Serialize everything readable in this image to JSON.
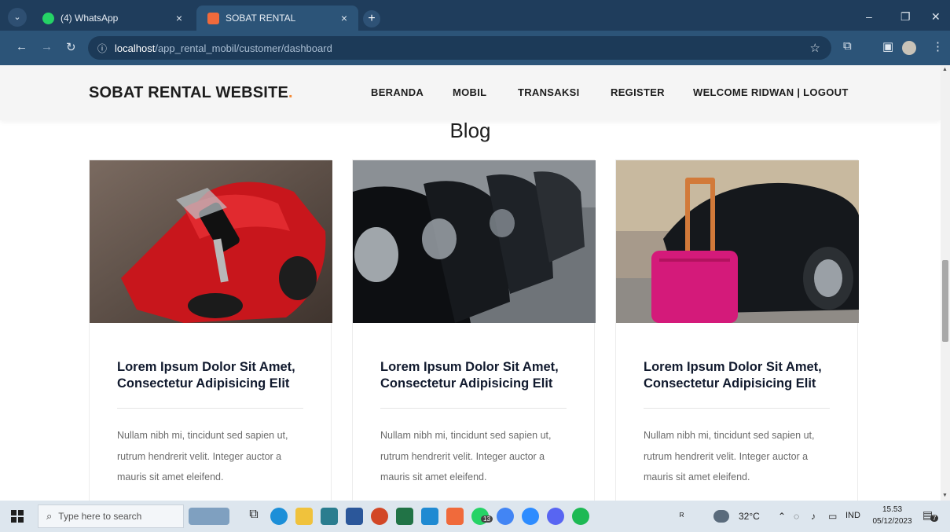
{
  "browser": {
    "tabs": [
      {
        "label": "(4) WhatsApp",
        "close": "×"
      },
      {
        "label": "SOBAT RENTAL",
        "close": "×"
      }
    ],
    "new_tab": "+",
    "window_controls": {
      "minimize": "–",
      "restore": "❐",
      "close": "✕"
    },
    "url_host": "localhost",
    "url_path": "/app_rental_mobil/customer/dashboard"
  },
  "site": {
    "brand": "SOBAT RENTAL WEBSITE",
    "brand_dot": ".",
    "menu": [
      "BERANDA",
      "MOBIL",
      "TRANSAKSI",
      "REGISTER",
      "WELCOME RIDWAN | LOGOUT"
    ],
    "blog_heading": "Blog",
    "cards": [
      {
        "title": "Lorem Ipsum Dolor Sit Amet, Consectetur Adipisicing Elit",
        "body": "Nullam nibh mi, tincidunt sed sapien ut, rutrum hendrerit velit. Integer auctor a mauris sit amet eleifend.",
        "image": "red-toy-car-with-keys"
      },
      {
        "title": "Lorem Ipsum Dolor Sit Amet, Consectetur Adipisicing Elit",
        "body": "Nullam nibh mi, tincidunt sed sapien ut, rutrum hendrerit velit. Integer auctor a mauris sit amet eleifend.",
        "image": "row-of-black-cars"
      },
      {
        "title": "Lorem Ipsum Dolor Sit Amet, Consectetur Adipisicing Elit",
        "body": "Nullam nibh mi, tincidunt sed sapien ut, rutrum hendrerit velit. Integer auctor a mauris sit amet eleifend.",
        "image": "pink-suitcase-by-car"
      }
    ]
  },
  "taskbar": {
    "search_placeholder": "Type here to search",
    "weather": "32°C",
    "language": "IND",
    "time": "15.53",
    "date": "05/12/2023",
    "whatsapp_badge": "13",
    "notifications_badge": "7"
  },
  "colors": {
    "accent_orange": "#f48c3a",
    "browser_dark": "#1f3d5c",
    "browser_toolbar": "#2c5478"
  }
}
